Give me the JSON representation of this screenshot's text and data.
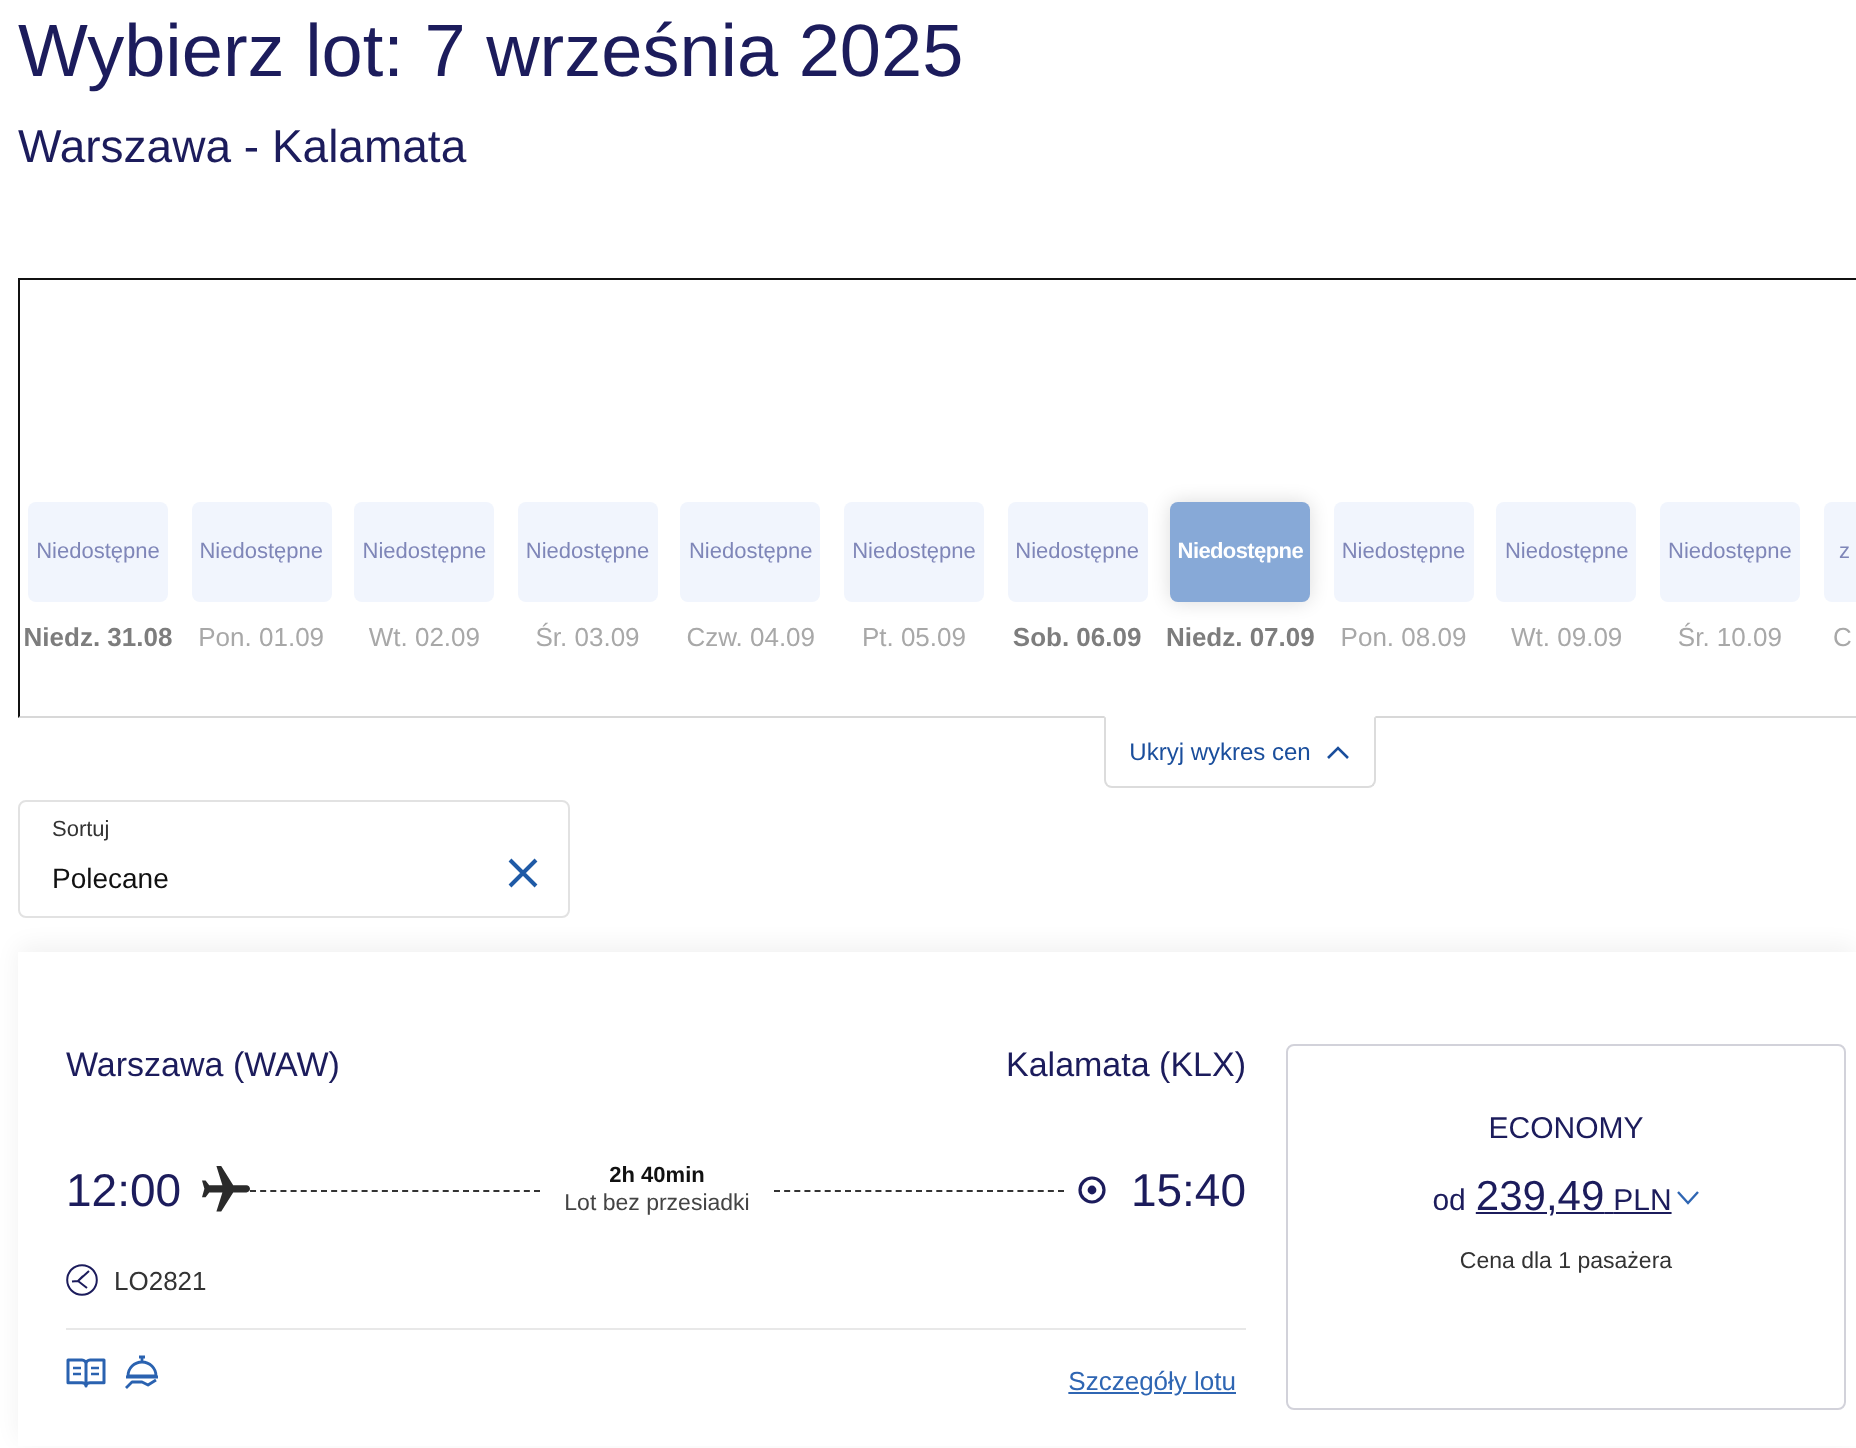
{
  "header": {
    "title": "Wybierz lot: 7 września 2025",
    "route": "Warszawa - Kalamata"
  },
  "price_chart": {
    "days": [
      {
        "kind": "full",
        "status": "Niedostępne",
        "date": "Niedz. 31.08",
        "selected": false,
        "highlighted": true
      },
      {
        "kind": "full",
        "status": "Niedostępne",
        "date": "Pon. 01.09",
        "selected": false,
        "highlighted": false
      },
      {
        "kind": "full",
        "status": "Niedostępne",
        "date": "Wt. 02.09",
        "selected": false,
        "highlighted": false
      },
      {
        "kind": "full",
        "status": "Niedostępne",
        "date": "Śr. 03.09",
        "selected": false,
        "highlighted": false
      },
      {
        "kind": "full",
        "status": "Niedostępne",
        "date": "Czw. 04.09",
        "selected": false,
        "highlighted": false
      },
      {
        "kind": "full",
        "status": "Niedostępne",
        "date": "Pt. 05.09",
        "selected": false,
        "highlighted": false
      },
      {
        "kind": "full",
        "status": "Niedostępne",
        "date": "Sob. 06.09",
        "selected": false,
        "highlighted": true
      },
      {
        "kind": "full",
        "status": "Niedostępne",
        "date": "Niedz. 07.09",
        "selected": true,
        "highlighted": true
      },
      {
        "kind": "full",
        "status": "Niedostępne",
        "date": "Pon. 08.09",
        "selected": false,
        "highlighted": false
      },
      {
        "kind": "full",
        "status": "Niedostępne",
        "date": "Wt. 09.09",
        "selected": false,
        "highlighted": false
      },
      {
        "kind": "full",
        "status": "Niedostępne",
        "date": "Śr. 10.09",
        "selected": false,
        "highlighted": false
      },
      {
        "kind": "cut",
        "status": "z",
        "date": "C",
        "selected": false,
        "highlighted": false
      }
    ],
    "toggle": "Ukryj wykres cen"
  },
  "sort": {
    "label": "Sortuj",
    "value": "Polecane"
  },
  "flight": {
    "origin": "Warszawa (WAW)",
    "destination": "Kalamata (KLX)",
    "departure": "12:00",
    "arrival": "15:40",
    "duration": "2h 40min",
    "stops": "Lot bez przesiadki",
    "flight_number": "LO2821",
    "details_link": "Szczegóły lotu",
    "fare": {
      "cabin": "ECONOMY",
      "prefix": "od",
      "amount": "239,49",
      "currency": "PLN",
      "note": "Cena dla 1 pasażera"
    }
  }
}
